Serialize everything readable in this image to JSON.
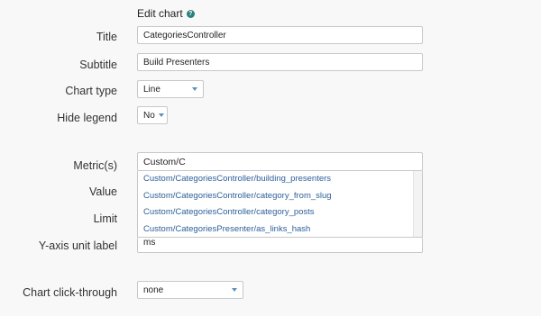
{
  "heading": {
    "title": "Edit chart",
    "help_glyph": "?"
  },
  "form": {
    "title": {
      "label": "Title",
      "value": "CategoriesController"
    },
    "subtitle": {
      "label": "Subtitle",
      "value": "Build Presenters"
    },
    "chart_type": {
      "label": "Chart type",
      "value": "Line"
    },
    "hide_legend": {
      "label": "Hide legend",
      "value": "No"
    },
    "metrics": {
      "label": "Metric(s)",
      "value": "Custom/C",
      "suggestions": [
        "Custom/CategoriesController/building_presenters",
        "Custom/CategoriesController/category_from_slug",
        "Custom/CategoriesController/category_posts",
        "Custom/CategoriesPresenter/as_links_hash"
      ]
    },
    "value": {
      "label": "Value"
    },
    "limit": {
      "label": "Limit"
    },
    "y_axis_unit": {
      "label": "Y-axis unit label",
      "value": "ms"
    },
    "click_through": {
      "label": "Chart click-through",
      "value": "none"
    }
  },
  "colors": {
    "accent": "#2a7f7f",
    "link": "#2d5f9a",
    "caret": "#5b8fb9"
  }
}
